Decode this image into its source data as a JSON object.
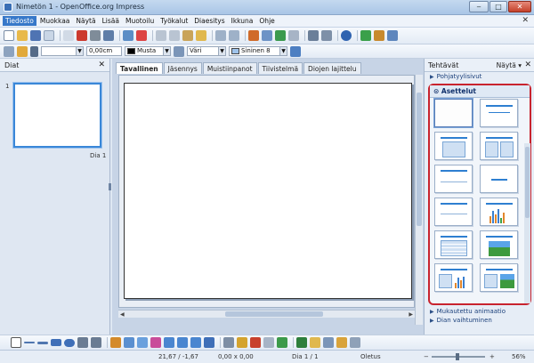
{
  "window": {
    "title": "Nimetön 1 - OpenOffice.org Impress",
    "minimize": "‒",
    "maximize": "□",
    "close": "✕"
  },
  "menu": {
    "items": [
      "Tiedosto",
      "Muokkaa",
      "Näytä",
      "Lisää",
      "Muotoilu",
      "Työkalut",
      "Diaesitys",
      "Ikkuna",
      "Ohje"
    ],
    "close": "✕"
  },
  "toolbar2": {
    "line_width": "0,00cm",
    "line_color": "Musta",
    "area_style": "Väri",
    "area_color": "Sininen 8",
    "colors": {
      "line": "#000000",
      "area": "#9fc3ea"
    }
  },
  "left_pane": {
    "title": "Diat",
    "close": "✕",
    "slide_number": "1",
    "slide_label": "Dia 1"
  },
  "tabs": [
    "Tavallinen",
    "Jäsennys",
    "Muistiinpanot",
    "Tiivistelmä",
    "Diojen lajittelu"
  ],
  "right_pane": {
    "title": "Tehtävät",
    "view": "Näytä",
    "close": "✕",
    "sections_top": [
      "Pohjatyylisivut"
    ],
    "layouts_title": "Asettelut",
    "sections_bottom": [
      "Mukautettu animaatio",
      "Dian vaihtuminen"
    ]
  },
  "status": {
    "position": "21,67 / -1,67",
    "size": "0,00 x 0,00",
    "slide": "Dia 1 / 1",
    "master": "Oletus",
    "zoom": "56%"
  },
  "accent": "#c8232e"
}
